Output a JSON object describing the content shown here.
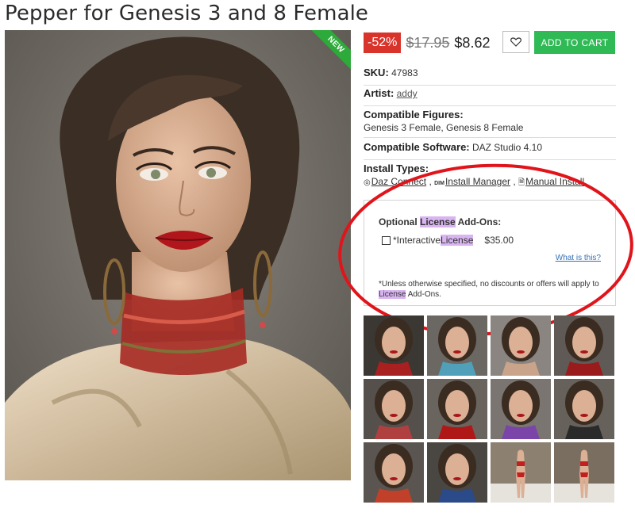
{
  "product": {
    "title": "Pepper for Genesis 3 and 8 Female",
    "badge": "NEW"
  },
  "pricing": {
    "discount": "-52%",
    "old_price": "$17.95",
    "new_price": "$8.62",
    "add_to_cart_label": "ADD TO CART"
  },
  "specs": {
    "sku_label": "SKU:",
    "sku_value": "47983",
    "artist_label": "Artist:",
    "artist_value": "addy",
    "figures_label": "Compatible Figures:",
    "figures_value": "Genesis 3 Female, Genesis 8 Female",
    "software_label": "Compatible Software:",
    "software_value": "DAZ Studio 4.10",
    "install_label": "Install Types:",
    "install_items": [
      "Daz Connect",
      "Install Manager",
      "Manual Install"
    ],
    "install_separator": " , "
  },
  "license": {
    "heading_prefix": "Optional ",
    "heading_highlight": "License",
    "heading_suffix": " Add-Ons:",
    "option_prefix": "*Interactive ",
    "option_highlight": "License",
    "option_price": "$35.00",
    "what_is_this": "What is this?",
    "footnote_text": "*Unless otherwise specified, no discounts or offers will apply to ",
    "footnote_highlight": "License",
    "footnote_suffix": " Add-Ons."
  },
  "colors": {
    "discount": "#d9342b",
    "add_to_cart": "#2fba55",
    "new_ribbon": "#2eaa3a",
    "highlight": "#d8b4f0",
    "annotation": "#e1141b",
    "link": "#3570b8"
  },
  "thumbnails": [
    {
      "name": "thumb-portrait-1",
      "bg": "#3b3733",
      "accent": "#a82020"
    },
    {
      "name": "thumb-portrait-2",
      "bg": "#6b6762",
      "accent": "#4fa0b8"
    },
    {
      "name": "thumb-portrait-3",
      "bg": "#8a8580",
      "accent": "#c9a48a"
    },
    {
      "name": "thumb-portrait-4",
      "bg": "#5f5a55",
      "accent": "#9a1b1b"
    },
    {
      "name": "thumb-portrait-5",
      "bg": "#55504b",
      "accent": "#b04040"
    },
    {
      "name": "thumb-portrait-6",
      "bg": "#6a645e",
      "accent": "#b01818"
    },
    {
      "name": "thumb-portrait-7",
      "bg": "#7a7570",
      "accent": "#7a44a8"
    },
    {
      "name": "thumb-portrait-8",
      "bg": "#66615b",
      "accent": "#2a2a2a"
    },
    {
      "name": "thumb-portrait-9",
      "bg": "#5a5550",
      "accent": "#c0402a"
    },
    {
      "name": "thumb-portrait-10",
      "bg": "#4a4641",
      "accent": "#2a4a8a"
    },
    {
      "name": "thumb-full-body-1",
      "bg": "#8c8070",
      "accent": "#c02020"
    },
    {
      "name": "thumb-full-body-2",
      "bg": "#7a6e60",
      "accent": "#c02020"
    }
  ]
}
